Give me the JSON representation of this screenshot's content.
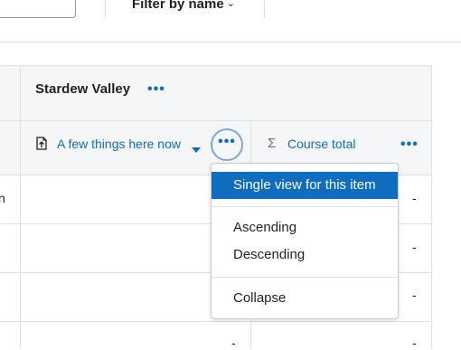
{
  "toolbar": {
    "filter_label": "Filter by name",
    "filter_chevron": "⌄"
  },
  "category": {
    "title": "Stardew Valley",
    "menu_icon": "•••"
  },
  "columns": {
    "item": {
      "icon": "grade-item-icon",
      "label": "A few things here now",
      "sort": "descending",
      "actions_icon": "•••"
    },
    "total": {
      "icon": "sigma-icon",
      "symbol": "Σ",
      "label": "Course total",
      "actions_icon": "•••"
    }
  },
  "rows": [
    {
      "left_fragment": "n",
      "total": "-"
    },
    {
      "left_fragment": "",
      "total": "-"
    },
    {
      "left_fragment": "",
      "total": "-"
    },
    {
      "left_fragment": "",
      "item": "-",
      "total": "-"
    }
  ],
  "dropdown": {
    "items": [
      {
        "label": "Single view for this item",
        "active": true
      },
      {
        "label": "Ascending"
      },
      {
        "label": "Descending"
      },
      {
        "label": "Collapse"
      }
    ]
  },
  "colors": {
    "accent": "#0f6cbf",
    "header_bg": "#f5f6f8",
    "border": "#dee2e6"
  }
}
